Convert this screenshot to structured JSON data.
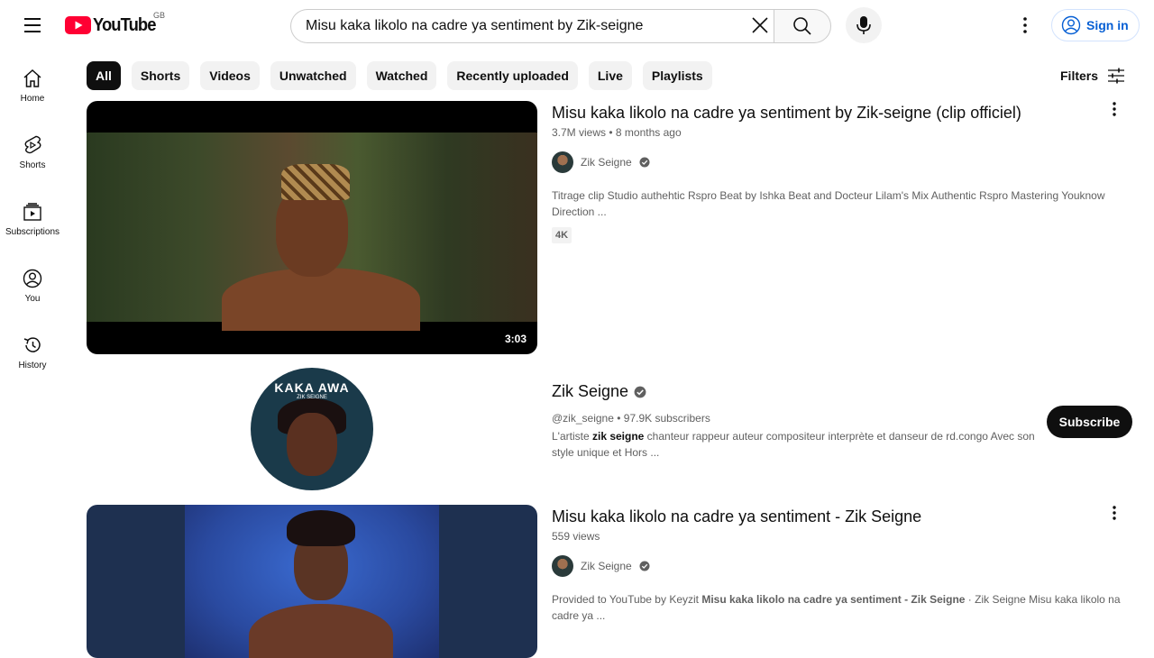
{
  "header": {
    "logo_text": "YouTube",
    "country_code": "GB",
    "search_value": "Misu kaka likolo na cadre ya sentiment by Zik-seigne",
    "signin_label": "Sign in"
  },
  "sidebar": {
    "items": [
      {
        "label": "Home",
        "icon": "home-icon"
      },
      {
        "label": "Shorts",
        "icon": "shorts-icon"
      },
      {
        "label": "Subscriptions",
        "icon": "subscriptions-icon"
      },
      {
        "label": "You",
        "icon": "you-icon"
      },
      {
        "label": "History",
        "icon": "history-icon"
      }
    ]
  },
  "chips": [
    "All",
    "Shorts",
    "Videos",
    "Unwatched",
    "Watched",
    "Recently uploaded",
    "Live",
    "Playlists"
  ],
  "filters_label": "Filters",
  "results": [
    {
      "title": "Misu kaka likolo na cadre ya sentiment by Zik-seigne (clip officiel)",
      "views": "3.7M views",
      "age": "8 months ago",
      "channel": "Zik Seigne",
      "description": "Titrage clip Studio authehtic Rspro Beat by Ishka Beat and Docteur Lilam's Mix Authentic Rspro Mastering Youknow Direction ...",
      "badge": "4K",
      "duration": "3:03"
    },
    {
      "title": "Misu kaka likolo na cadre ya sentiment - Zik Seigne",
      "views": "559 views",
      "channel": "Zik Seigne",
      "desc_pre": "Provided to YouTube by Keyzit ",
      "desc_bold": "Misu kaka likolo na cadre ya sentiment - Zik Seigne",
      "desc_post": " · Zik Seigne Misu kaka likolo na cadre ya ..."
    }
  ],
  "channel_card": {
    "name": "Zik Seigne",
    "handle": "@zik_seigne",
    "subscribers": "97.9K subscribers",
    "desc_pre": "L'artiste ",
    "desc_bold": "zik seigne",
    "desc_post": " chanteur rappeur auteur compositeur interprète et danseur de rd.congo Avec son style unique et Hors ...",
    "subscribe_label": "Subscribe",
    "avatar_title": "KAKA AWA",
    "avatar_sub": "ZIK SEIGNE"
  }
}
